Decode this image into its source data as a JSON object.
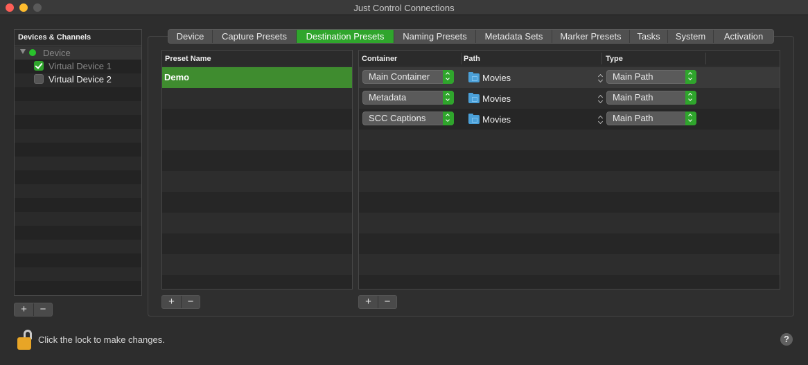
{
  "window": {
    "title": "Just Control Connections"
  },
  "sidebar": {
    "header": "Devices & Channels",
    "device_label": "Device",
    "channels": [
      {
        "label": "Virtual Device 1",
        "checked": true
      },
      {
        "label": "Virtual Device 2",
        "checked": false
      }
    ],
    "add_label": "+",
    "remove_label": "−"
  },
  "tabs": [
    {
      "label": "Device",
      "active": false
    },
    {
      "label": "Capture Presets",
      "active": false
    },
    {
      "label": "Destination Presets",
      "active": true
    },
    {
      "label": "Naming Presets",
      "active": false
    },
    {
      "label": "Metadata Sets",
      "active": false
    },
    {
      "label": "Marker Presets",
      "active": false
    },
    {
      "label": "Tasks",
      "active": false
    },
    {
      "label": "System",
      "active": false
    },
    {
      "label": "Activation",
      "active": false
    }
  ],
  "presets": {
    "header": "Preset Name",
    "items": [
      "Demo"
    ],
    "add_label": "+",
    "remove_label": "−"
  },
  "destinations": {
    "headers": {
      "container": "Container",
      "path": "Path",
      "type": "Type"
    },
    "rows": [
      {
        "container": "Main Container",
        "path": "Movies",
        "type": "Main Path"
      },
      {
        "container": "Metadata",
        "path": "Movies",
        "type": "Main Path"
      },
      {
        "container": "SCC Captions",
        "path": "Movies",
        "type": "Main Path"
      }
    ],
    "add_label": "+",
    "remove_label": "−"
  },
  "footer": {
    "lock_text": "Click the lock to make changes.",
    "help_label": "?"
  },
  "colors": {
    "accent_green": "#2fa52c",
    "selected_row": "#3f8c2f",
    "folder_blue": "#4ba0d8"
  }
}
